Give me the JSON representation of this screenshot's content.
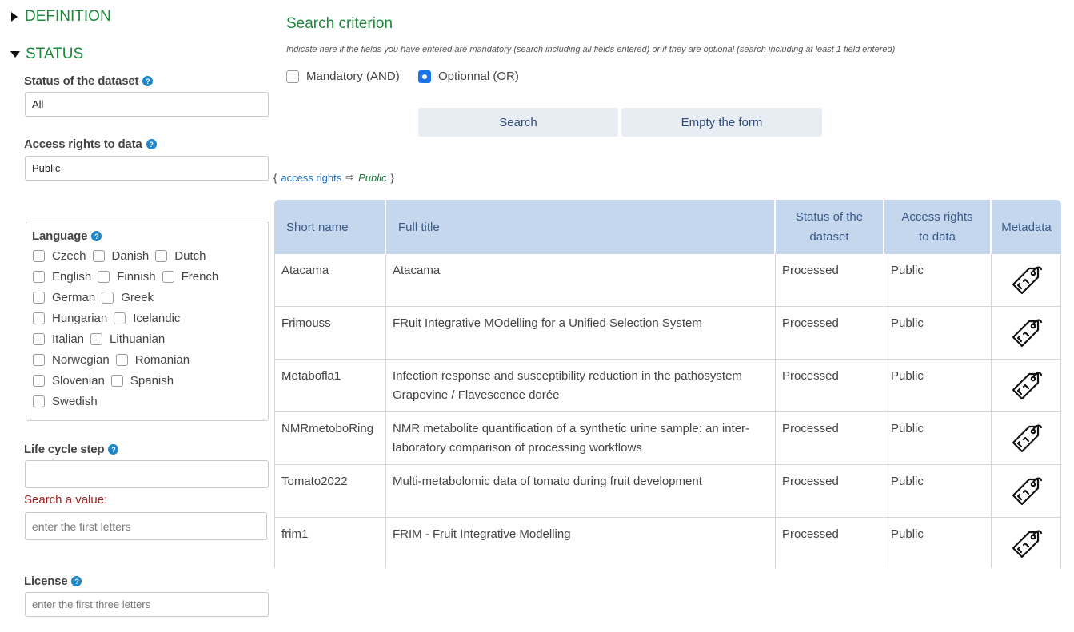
{
  "sections": {
    "definition": "DEFINITION",
    "status": "STATUS"
  },
  "filters": {
    "status_label": "Status of the dataset",
    "status_value": "All",
    "access_label": "Access rights to data",
    "access_value": "Public",
    "language_label": "Language",
    "languages": [
      "Czech",
      "Danish",
      "Dutch",
      "English",
      "Finnish",
      "French",
      "German",
      "Greek",
      "Hungarian",
      "Icelandic",
      "Italian",
      "Lithuanian",
      "Norwegian",
      "Romanian",
      "Slovenian",
      "Spanish",
      "Swedish"
    ],
    "lifecycle_label": "Life cycle step",
    "lifecycle_value": "",
    "search_value_label": "Search a value:",
    "search_value_placeholder": "enter the first letters",
    "license_label": "License",
    "license_placeholder": "enter the first three letters",
    "help_glyph": "?"
  },
  "criterion": {
    "title": "Search criterion",
    "hint": "Indicate here if the fields you have entered are mandatory (search including all fields entered) or if they are optional (search including at least 1 field entered)",
    "mandatory_label": "Mandatory (AND)",
    "optional_label": "Optionnal (OR)",
    "selected": "optional",
    "search_button": "Search",
    "empty_button": "Empty the form"
  },
  "active_filter": {
    "open_brace": "{",
    "key": "access rights",
    "arrow": "⇨",
    "value": "Public",
    "close_brace": "}"
  },
  "table": {
    "headers": {
      "short_name": "Short name",
      "full_title": "Full title",
      "status_line1": "Status of the",
      "status_line2": "dataset",
      "access_line1": "Access rights",
      "access_line2": "to data",
      "metadata": "Metadata"
    },
    "rows": [
      {
        "short": "Atacama",
        "title": "Atacama",
        "status": "Processed",
        "access": "Public"
      },
      {
        "short": "Frimouss",
        "title": "FRuit Integrative MOdelling for a Unified Selection System",
        "status": "Processed",
        "access": "Public"
      },
      {
        "short": "Metabofla1",
        "title": "Infection response and susceptibility reduction in the pathosystem Grapevine / Flavescence dorée",
        "status": "Processed",
        "access": "Public"
      },
      {
        "short": "NMRmetoboRing",
        "title": "NMR metabolite quantification of a synthetic urine sample: an inter-laboratory comparison of processing workflows",
        "status": "Processed",
        "access": "Public"
      },
      {
        "short": "Tomato2022",
        "title": "Multi-metabolomic data of tomato during fruit development",
        "status": "Processed",
        "access": "Public"
      },
      {
        "short": "frim1",
        "title": "FRIM - Fruit Integrative Modelling",
        "status": "Processed",
        "access": "Public"
      }
    ]
  },
  "colors": {
    "section_green": "#1a8a3a",
    "header_blue": "#c5d7ec",
    "radio_selected": "#1a73e8",
    "warning_red": "#a32020"
  },
  "icons": {
    "definition_toggle": "triangle-right-icon",
    "status_toggle": "triangle-down-icon",
    "help": "help-icon",
    "metadata": "tag-icon"
  }
}
